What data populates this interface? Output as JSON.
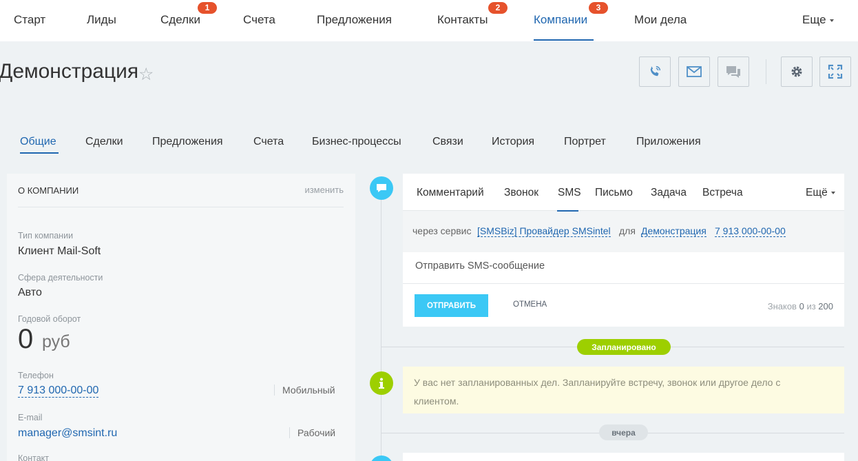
{
  "topnav": {
    "items": [
      {
        "label": "Старт"
      },
      {
        "label": "Лиды"
      },
      {
        "label": "Сделки",
        "badge": "1"
      },
      {
        "label": "Счета"
      },
      {
        "label": "Предложения"
      },
      {
        "label": "Контакты",
        "badge": "2"
      },
      {
        "label": "Компании",
        "badge": "3",
        "active": true
      },
      {
        "label": "Мои дела"
      },
      {
        "label": "Еще"
      }
    ]
  },
  "header": {
    "title": "Демонстрация",
    "star": "☆",
    "buttons": [
      "phone-icon",
      "mail-icon",
      "chat-icon",
      "gear-icon",
      "expand-icon"
    ]
  },
  "detail_tabs": [
    "Общие",
    "Сделки",
    "Предложения",
    "Счета",
    "Бизнес-процессы",
    "Связи",
    "История",
    "Портрет",
    "Приложения"
  ],
  "company_card": {
    "title": "О КОМПАНИИ",
    "edit_label": "изменить",
    "fields": {
      "type_label": "Тип компании",
      "type_value": "Клиент Mail-Soft",
      "industry_label": "Сфера деятельности",
      "industry_value": "Авто",
      "revenue_label": "Годовой оборот",
      "revenue_value": "0",
      "revenue_currency": "руб",
      "phone_label": "Телефон",
      "phone_value": "7 913 000-00-00",
      "phone_type": "Мобильный",
      "email_label": "E-mail",
      "email_value": "manager@smsint.ru",
      "email_type": "Рабочий",
      "contact_label": "Контакт"
    }
  },
  "activity_editor": {
    "tabs": [
      "Комментарий",
      "Звонок",
      "SMS",
      "Письмо",
      "Задача",
      "Встреча",
      "Ещё"
    ],
    "active_tab": "SMS",
    "via_text": "через сервис",
    "provider": "[SMSBiz] Провайдер SMSintel",
    "for_text": "для",
    "recipient": "Демонстрация",
    "recipient_phone": "7 913 000-00-00",
    "placeholder": "Отправить SMS-сообщение",
    "send_label": "ОТПРАВИТЬ",
    "cancel_label": "ОТМЕНА",
    "counter_label": "Знаков",
    "counter_value": "0",
    "counter_of": "из",
    "counter_max": "200"
  },
  "timeline": {
    "planned_label": "Запланировано",
    "planned_color": "#9dcf00",
    "empty_notice": "У вас нет запланированных дел. Запланируйте встречу, звонок или другое дело с клиентом.",
    "yesterday_label": "вчера"
  },
  "colors": {
    "accent": "#2067b0",
    "badge": "#e6522c",
    "send_button": "#3bc8f5",
    "timeline_dot": "#3bc8f5",
    "info_dot": "#9dcf00"
  }
}
